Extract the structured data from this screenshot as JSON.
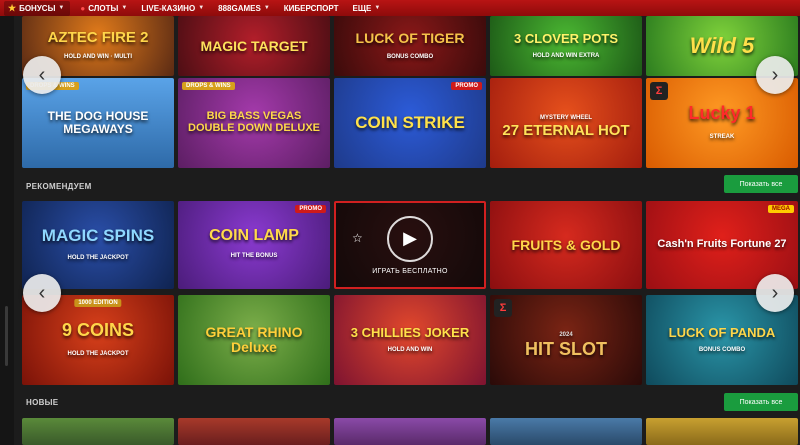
{
  "nav": {
    "items": [
      {
        "label": "БОНУСЫ",
        "icon": "star-icon",
        "active": true
      },
      {
        "label": "СЛОТЫ",
        "icon": "cherry-icon"
      },
      {
        "label": "LIVE-КАЗИНО"
      },
      {
        "label": "888GAMES"
      },
      {
        "label": "КИБЕРСПОРТ"
      },
      {
        "label": "ЕЩЕ"
      }
    ]
  },
  "row1": [
    {
      "title": "AZTEC FIRE 2",
      "sub": "HOLD AND WIN · MULTI",
      "bg": "#5a2a14"
    },
    {
      "title": "MAGIC TARGET",
      "sub": "",
      "bg": "#4d0e14"
    },
    {
      "title": "LUCK OF TIGER",
      "sub": "BONUS COMBO",
      "bg": "#3b0b0b"
    },
    {
      "title": "3 CLOVER POTS",
      "sub": "HOLD AND WIN EXTRA",
      "bg": "#1d5a17"
    },
    {
      "title": "Wild 5",
      "sub": "",
      "bg": "#2c7d1f"
    }
  ],
  "row2": [
    {
      "title": "THE DOG HOUSE MEGAWAYS",
      "badge": "DROPS & WINS",
      "bg": "#2e6aa8"
    },
    {
      "title": "BIG BASS VEGAS DOUBLE DOWN DELUXE",
      "badge": "DROPS & WINS",
      "bg": "#5c1e63"
    },
    {
      "title": "COIN STRIKE",
      "badge": "PROMO",
      "bg": "#1e3a8a"
    },
    {
      "title": "27 ETERNAL HOT",
      "sub": "MYSTERY WHEEL",
      "bg": "#a31d0e"
    },
    {
      "title": "Lucky 1",
      "sub": "STREAK",
      "bg": "#d95b00"
    }
  ],
  "sections": {
    "recommended": {
      "title": "РЕКОМЕНДУЕМ",
      "button": "Показать все"
    },
    "new": {
      "title": "НОВЫЕ",
      "button": "Показать все"
    }
  },
  "row3": [
    {
      "title": "MAGIC SPINS",
      "sub": "HOLD THE JACKPOT",
      "bg": "#0f2350"
    },
    {
      "title": "COIN LAMP",
      "sub": "HIT THE BONUS",
      "badge": "PROMO",
      "bg": "#4b1c7a"
    },
    {
      "title": "",
      "bg": "#2a1515",
      "overlay": "ИГРАТЬ БЕСПЛАТНО"
    },
    {
      "title": "FRUITS & GOLD",
      "bg": "#8a0e10"
    },
    {
      "title": "Cash'n Fruits Fortune 27",
      "badge": "MEGA",
      "bg": "#9b0f14"
    }
  ],
  "row4": [
    {
      "title": "9 COINS",
      "sub": "HOLD THE JACKPOT",
      "badge": "1000 EDITION",
      "bg": "#7a1208"
    },
    {
      "title": "GREAT RHINO Deluxe",
      "bg": "#2f6e1a"
    },
    {
      "title": "3 CHILLIES JOKER",
      "sub": "HOLD AND WIN",
      "bg": "#7d1330"
    },
    {
      "title": "HIT SLOT",
      "sub": "2024",
      "bg": "#2a0a08"
    },
    {
      "title": "LUCK OF PANDA",
      "sub": "BONUS COMBO",
      "bg": "#0f4a5c"
    }
  ],
  "row5": [
    {
      "bg": "#3a5a2a"
    },
    {
      "bg": "#6a1e1e"
    },
    {
      "bg": "#5a2a6a"
    },
    {
      "bg": "#2a4a6a"
    },
    {
      "bg": "#8a6a1a"
    }
  ]
}
